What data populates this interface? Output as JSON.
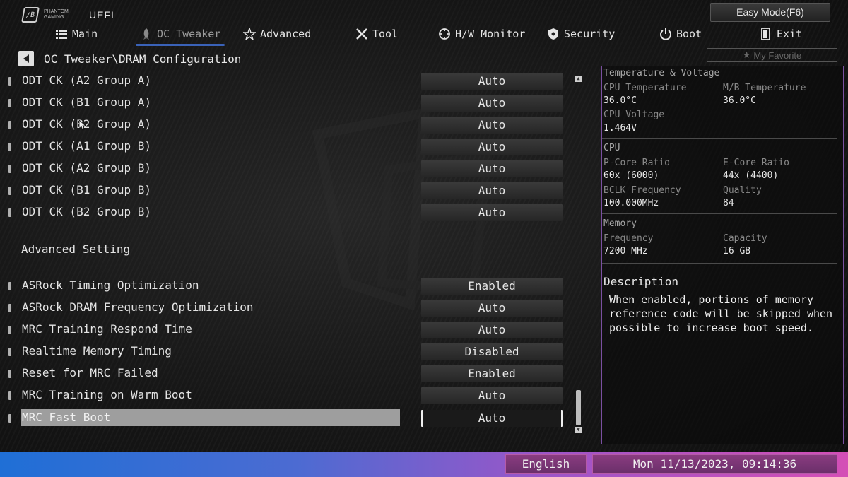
{
  "header": {
    "brand": "PHANTOM GAMING",
    "uefi_label": "UEFI",
    "easy_mode_label": "Easy Mode(F6)"
  },
  "nav": {
    "tabs": [
      {
        "label": "Main",
        "icon": "list-icon",
        "active": false
      },
      {
        "label": "OC Tweaker",
        "icon": "rocket-icon",
        "active": true
      },
      {
        "label": "Advanced",
        "icon": "star-icon",
        "active": false
      },
      {
        "label": "Tool",
        "icon": "tools-icon",
        "active": false
      },
      {
        "label": "H/W Monitor",
        "icon": "monitor-icon",
        "active": false
      },
      {
        "label": "Security",
        "icon": "shield-icon",
        "active": false
      },
      {
        "label": "Boot",
        "icon": "power-icon",
        "active": false
      },
      {
        "label": "Exit",
        "icon": "exit-icon",
        "active": false
      }
    ]
  },
  "breadcrumb": {
    "path": "OC Tweaker\\DRAM Configuration"
  },
  "favorite": {
    "label": "My Favorite"
  },
  "settings": {
    "rows_top": [
      {
        "label": "ODT CK (A2 Group A)",
        "value": "Auto"
      },
      {
        "label": "ODT CK (B1 Group A)",
        "value": "Auto"
      },
      {
        "label": "ODT CK (B2 Group A)",
        "value": "Auto"
      },
      {
        "label": "ODT CK (A1 Group B)",
        "value": "Auto"
      },
      {
        "label": "ODT CK (A2 Group B)",
        "value": "Auto"
      },
      {
        "label": "ODT CK (B1 Group B)",
        "value": "Auto"
      },
      {
        "label": "ODT CK (B2 Group B)",
        "value": "Auto"
      }
    ],
    "section_title": "Advanced Setting",
    "rows_bottom": [
      {
        "label": "ASRock Timing Optimization",
        "value": "Enabled"
      },
      {
        "label": "ASRock DRAM Frequency Optimization",
        "value": "Auto"
      },
      {
        "label": "MRC Training Respond Time",
        "value": "Auto"
      },
      {
        "label": "Realtime Memory Timing",
        "value": "Disabled"
      },
      {
        "label": "Reset for MRC Failed",
        "value": "Enabled"
      },
      {
        "label": "MRC Training on Warm Boot",
        "value": "Auto"
      },
      {
        "label": "MRC Fast Boot",
        "value": "Auto",
        "selected": true
      }
    ]
  },
  "panel": {
    "temp_header": "Temperature & Voltage",
    "cpu_temp_label": "CPU Temperature",
    "cpu_temp_value": "36.0°C",
    "mb_temp_label": "M/B Temperature",
    "mb_temp_value": "36.0°C",
    "cpu_volt_label": "CPU Voltage",
    "cpu_volt_value": "1.464V",
    "cpu_header": "CPU",
    "pcore_label": "P-Core Ratio",
    "pcore_value": "60x (6000)",
    "ecore_label": "E-Core Ratio",
    "ecore_value": "44x (4400)",
    "bclk_label": "BCLK Frequency",
    "bclk_value": "100.000MHz",
    "quality_label": "Quality",
    "quality_value": "84",
    "mem_header": "Memory",
    "freq_label": "Frequency",
    "freq_value": "7200 MHz",
    "cap_label": "Capacity",
    "cap_value": "16 GB",
    "desc_title": "Description",
    "desc_text": "When enabled, portions of memory reference code will be skipped when possible to increase boot speed."
  },
  "footer": {
    "language": "English",
    "datetime": "Mon 11/13/2023, 09:14:36"
  },
  "colors": {
    "accent_tab": "#3a62b8",
    "panel_border": "#7a4fa0",
    "footer_left": "#1f6fd6",
    "footer_right": "#d44fb6"
  }
}
